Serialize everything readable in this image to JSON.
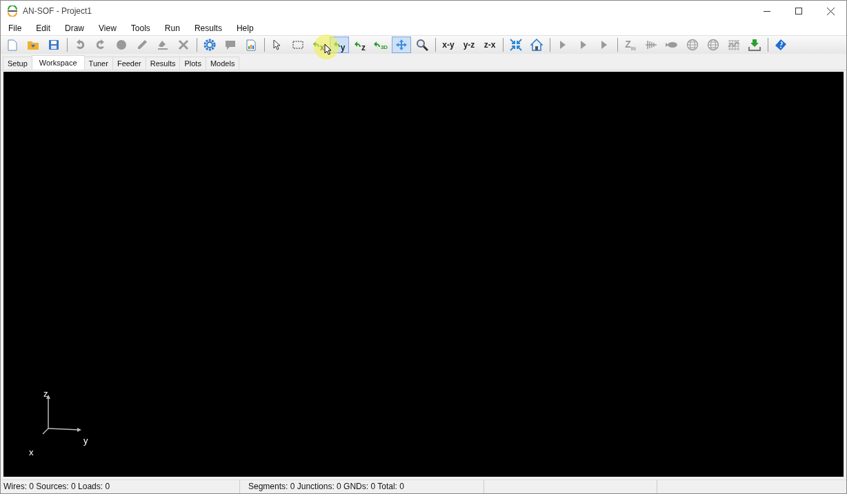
{
  "window": {
    "title": "AN-SOF - Project1"
  },
  "menu": [
    "File",
    "Edit",
    "Draw",
    "View",
    "Tools",
    "Run",
    "Results",
    "Help"
  ],
  "toolbar": [
    {
      "kind": "newfile",
      "disabled": false,
      "selected": false
    },
    {
      "kind": "open",
      "disabled": false,
      "selected": false
    },
    {
      "kind": "save",
      "disabled": false,
      "selected": false
    },
    {
      "kind": "separator"
    },
    {
      "kind": "undo",
      "disabled": true,
      "selected": false
    },
    {
      "kind": "redo",
      "disabled": true,
      "selected": false
    },
    {
      "kind": "circle",
      "disabled": true,
      "selected": false
    },
    {
      "kind": "pencil",
      "disabled": true,
      "selected": false
    },
    {
      "kind": "eraser",
      "disabled": true,
      "selected": false
    },
    {
      "kind": "delete",
      "disabled": true,
      "selected": false
    },
    {
      "kind": "separator"
    },
    {
      "kind": "gear",
      "disabled": false,
      "selected": false
    },
    {
      "kind": "comment",
      "disabled": true,
      "selected": false
    },
    {
      "kind": "report",
      "disabled": false,
      "selected": false
    },
    {
      "kind": "separator"
    },
    {
      "kind": "pointer",
      "disabled": false,
      "selected": false
    },
    {
      "kind": "marquee",
      "disabled": false,
      "selected": false
    },
    {
      "kind": "rotate",
      "label": "x",
      "disabled": false,
      "selected": false
    },
    {
      "kind": "rotate",
      "label": "y",
      "disabled": false,
      "selected": true
    },
    {
      "kind": "rotate",
      "label": "z",
      "disabled": false,
      "selected": false
    },
    {
      "kind": "rotate",
      "label": "3D",
      "disabled": false,
      "selected": false
    },
    {
      "kind": "pan",
      "disabled": false,
      "selected": true
    },
    {
      "kind": "zoom",
      "disabled": false,
      "selected": false
    },
    {
      "kind": "separator"
    },
    {
      "kind": "text",
      "label": "x-y",
      "disabled": false,
      "selected": false
    },
    {
      "kind": "text",
      "label": "y-z",
      "disabled": false,
      "selected": false
    },
    {
      "kind": "text",
      "label": "z-x",
      "disabled": false,
      "selected": false
    },
    {
      "kind": "separator"
    },
    {
      "kind": "fit",
      "disabled": false,
      "selected": false
    },
    {
      "kind": "home",
      "disabled": false,
      "selected": false
    },
    {
      "kind": "separator"
    },
    {
      "kind": "play",
      "disabled": true,
      "selected": false
    },
    {
      "kind": "play",
      "disabled": true,
      "selected": false
    },
    {
      "kind": "play",
      "disabled": true,
      "selected": false
    },
    {
      "kind": "separator"
    },
    {
      "kind": "impedance",
      "label": "Z",
      "sublabel": "IN",
      "disabled": true,
      "selected": false
    },
    {
      "kind": "antenna",
      "disabled": true,
      "selected": false
    },
    {
      "kind": "blob",
      "disabled": true,
      "selected": false
    },
    {
      "kind": "globe",
      "disabled": true,
      "selected": false
    },
    {
      "kind": "globe",
      "disabled": true,
      "selected": false
    },
    {
      "kind": "chart",
      "disabled": true,
      "selected": false
    },
    {
      "kind": "download",
      "disabled": false,
      "selected": false
    },
    {
      "kind": "separator"
    },
    {
      "kind": "book",
      "disabled": false,
      "selected": false
    }
  ],
  "tabs": [
    {
      "label": "Setup",
      "selected": false
    },
    {
      "label": "Workspace",
      "selected": true
    },
    {
      "label": "Tuner",
      "selected": false
    },
    {
      "label": "Feeder",
      "selected": false
    },
    {
      "label": "Results",
      "selected": false
    },
    {
      "label": "Plots",
      "selected": false
    },
    {
      "label": "Models",
      "selected": false
    }
  ],
  "axes": {
    "z": "z",
    "y": "y",
    "x": "x"
  },
  "status_bar": [
    "Wires: 0  Sources: 0  Loads: 0",
    "Segments: 0  Junctions: 0  GNDs: 0  Total: 0"
  ]
}
